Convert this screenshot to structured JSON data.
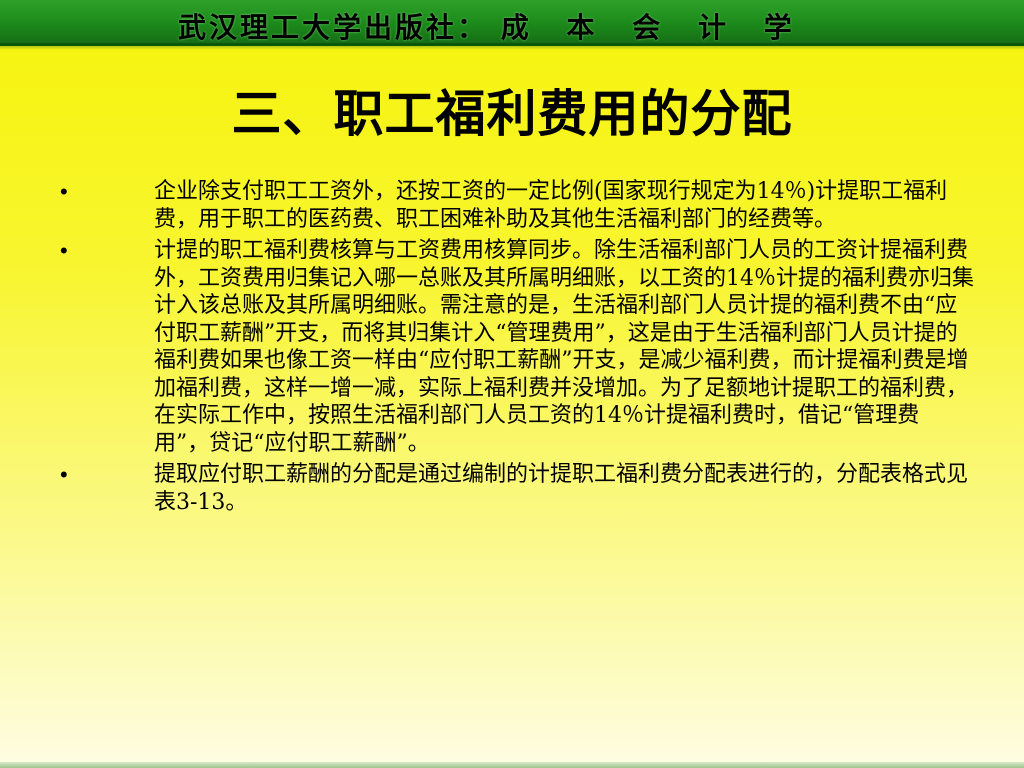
{
  "banner": {
    "publisher": "武汉理工大学出版社：",
    "course": "成 本 会 计 学"
  },
  "title": "三、职工福利费用的分配",
  "items": [
    {
      "bullet": "•",
      "text": "企业除支付职工工资外，还按工资的一定比例(国家现行规定为14％)计提职工福利费，用于职工的医药费、职工困难补助及其他生活福利部门的经费等。"
    },
    {
      "bullet": "•",
      "text": "计提的职工福利费核算与工资费用核算同步。除生活福利部门人员的工资计提福利费外，工资费用归集记入哪一总账及其所属明细账，以工资的14％计提的福利费亦归集计入该总账及其所属明细账。需注意的是，生活福利部门人员计提的福利费不由“应付职工薪酬”开支，而将其归集计入“管理费用”，这是由于生活福利部门人员计提的福利费如果也像工资一样由“应付职工薪酬”开支，是减少福利费，而计提福利费是增加福利费，这样一增一减，实际上福利费并没增加。为了足额地计提职工的福利费，在实际工作中，按照生活福利部门人员工资的14％计提福利费时，借记“管理费用”，贷记“应付职工薪酬”。"
    },
    {
      "bullet": "•",
      "text": "提取应付职工薪酬的分配是通过编制的计提职工福利费分配表进行的，分配表格式见表3-13。"
    }
  ]
}
